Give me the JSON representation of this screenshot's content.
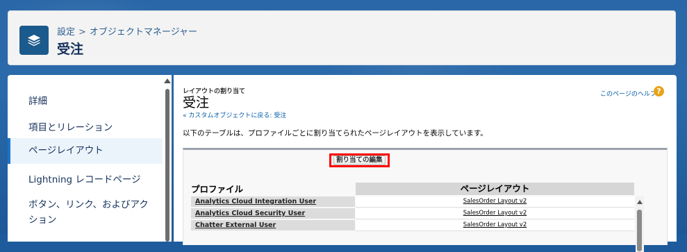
{
  "header": {
    "breadcrumb": [
      "設定",
      "オブジェクトマネージャー"
    ],
    "separator": ">",
    "title": "受注",
    "icon": "layers-icon"
  },
  "sidebar": {
    "items": [
      {
        "label": "詳細",
        "active": false
      },
      {
        "label": "項目とリレーション",
        "active": false
      },
      {
        "label": "ページレイアウト",
        "active": true
      },
      {
        "label": "Lightning レコードページ",
        "active": false
      },
      {
        "label": "ボタン、リンク、およびアクション",
        "active": false
      }
    ],
    "active_color": "#1b73c8"
  },
  "main": {
    "section_label": "レイアウトの割り当て",
    "section_title": "受注",
    "back_link": "« カスタムオブジェクトに戻る: 受注",
    "help_link": "このページのヘルプ",
    "help_icon": "?",
    "description": "以下のテーブルは、プロファイルごとに割り当てられたページレイアウトを表示しています。",
    "edit_button": "割り当ての編集",
    "highlight_color": "#ff0000",
    "table": {
      "headers": [
        "プロファイル",
        "ページレイアウト"
      ],
      "rows": [
        {
          "profile": "Analytics Cloud Integration User",
          "layout": "SalesOrder Layout v2"
        },
        {
          "profile": "Analytics Cloud Security User",
          "layout": "SalesOrder Layout v2"
        },
        {
          "profile": "Chatter External User",
          "layout": "SalesOrder Layout v2"
        }
      ]
    }
  }
}
